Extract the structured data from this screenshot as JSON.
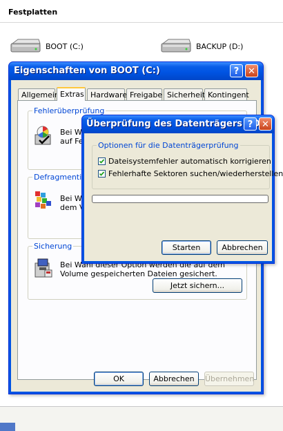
{
  "explorer": {
    "section_heading": "Festplatten",
    "drives": [
      {
        "label": "BOOT (C:)"
      },
      {
        "label": "BACKUP (D:)"
      }
    ]
  },
  "properties_dialog": {
    "title": "Eigenschaften von BOOT (C:)",
    "help_symbol": "?",
    "close_symbol": "✕",
    "tabs": [
      {
        "label": "Allgemein"
      },
      {
        "label": "Extras"
      },
      {
        "label": "Hardware"
      },
      {
        "label": "Freigabe"
      },
      {
        "label": "Sicherheit"
      },
      {
        "label": "Kontingent"
      }
    ],
    "active_tab": "Extras",
    "groups": {
      "error_check": {
        "title": "Fehlerüberprüfung",
        "text_line1": "Bei Wa",
        "text_line2": "auf Fehl"
      },
      "defrag": {
        "title": "Defragmentieru",
        "text_line1": "Bei Wa",
        "text_line2": "dem Vo"
      },
      "backup": {
        "title": "Sicherung",
        "text_line1": "Bei Wahl dieser Option werden die auf dem",
        "text_line2": "Volume gespeicherten Dateien gesichert.",
        "button": "Jetzt sichern..."
      }
    },
    "buttons": {
      "ok": "OK",
      "cancel": "Abbrechen",
      "apply": "Übernehmen"
    }
  },
  "check_dialog": {
    "title": "Überprüfung des Datenträgers BO...",
    "help_symbol": "?",
    "close_symbol": "✕",
    "options_group_title": "Optionen für die Datenträgerprüfung",
    "options": [
      {
        "label": "Dateisystemfehler automatisch korrigieren",
        "checked": true
      },
      {
        "label": "Fehlerhafte Sektoren suchen/wiederherstellen",
        "checked": true
      }
    ],
    "progress": 0,
    "buttons": {
      "start": "Starten",
      "cancel": "Abbrechen"
    }
  },
  "colors": {
    "xp_title_blue": "#0054e3",
    "dialog_face": "#ece9d8",
    "group_title_blue": "#0046d5",
    "close_button_red": "#c8441c"
  }
}
